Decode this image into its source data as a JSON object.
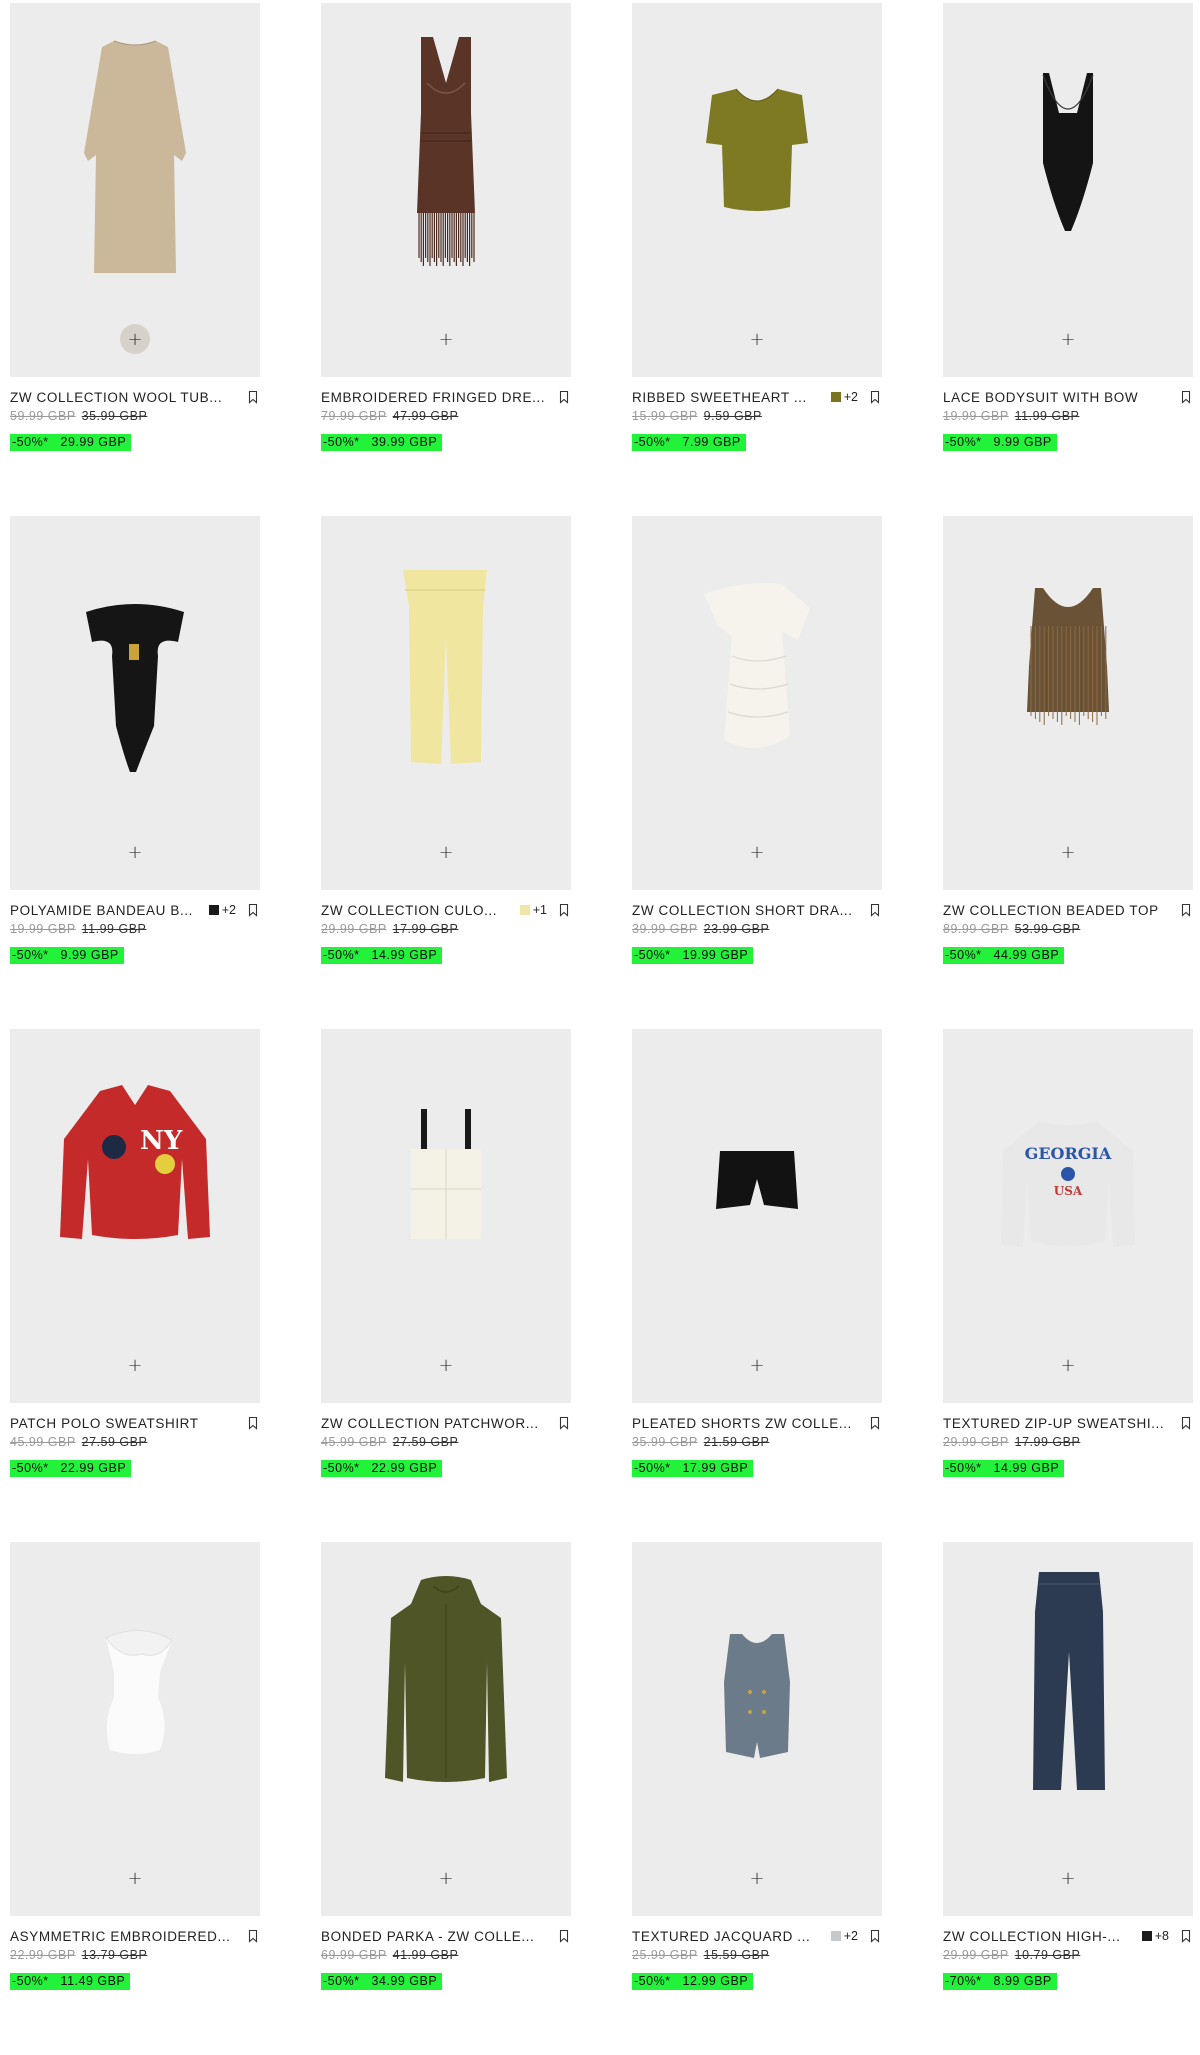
{
  "products": [
    {
      "name": "ZW COLLECTION WOOL TUB...",
      "old_price": "59.99 GBP",
      "mid_price": "35.99 GBP",
      "discount": "-50%*",
      "sale_price": "29.99 GBP",
      "swatch": null,
      "swatch_more": "",
      "add_label": "+",
      "art": "dress-long",
      "highlight": true
    },
    {
      "name": "EMBROIDERED FRINGED DRE...",
      "old_price": "79.99 GBP",
      "mid_price": "47.99 GBP",
      "discount": "-50%*",
      "sale_price": "39.99 GBP",
      "swatch": null,
      "swatch_more": "",
      "add_label": "+",
      "art": "dress-fringe",
      "highlight": false
    },
    {
      "name": "RIBBED SWEETHEART ...",
      "old_price": "15.99 GBP",
      "mid_price": "9.59 GBP",
      "discount": "-50%*",
      "sale_price": "7.99 GBP",
      "swatch": "#7a7420",
      "swatch_more": "+2",
      "add_label": "+",
      "art": "top-sweetheart",
      "highlight": false
    },
    {
      "name": "LACE BODYSUIT WITH BOW",
      "old_price": "19.99 GBP",
      "mid_price": "11.99 GBP",
      "discount": "-50%*",
      "sale_price": "9.99 GBP",
      "swatch": null,
      "swatch_more": "",
      "add_label": "+",
      "art": "bodysuit-lace",
      "highlight": false
    },
    {
      "name": "POLYAMIDE BANDEAU B...",
      "old_price": "19.99 GBP",
      "mid_price": "11.99 GBP",
      "discount": "-50%*",
      "sale_price": "9.99 GBP",
      "swatch": "#1a1a1a",
      "swatch_more": "+2",
      "add_label": "+",
      "art": "bodysuit-bandeau",
      "highlight": false
    },
    {
      "name": "ZW COLLECTION CULO...",
      "old_price": "29.99 GBP",
      "mid_price": "17.99 GBP",
      "discount": "-50%*",
      "sale_price": "14.99 GBP",
      "swatch": "#f1e4a8",
      "swatch_more": "+1",
      "add_label": "+",
      "art": "culottes",
      "highlight": false
    },
    {
      "name": "ZW COLLECTION SHORT DRA...",
      "old_price": "39.99 GBP",
      "mid_price": "23.99 GBP",
      "discount": "-50%*",
      "sale_price": "19.99 GBP",
      "swatch": null,
      "swatch_more": "",
      "add_label": "+",
      "art": "dress-short",
      "highlight": false
    },
    {
      "name": "ZW COLLECTION BEADED TOP",
      "old_price": "89.99 GBP",
      "mid_price": "53.99 GBP",
      "discount": "-50%*",
      "sale_price": "44.99 GBP",
      "swatch": null,
      "swatch_more": "",
      "add_label": "+",
      "art": "top-beaded",
      "highlight": false
    },
    {
      "name": "PATCH POLO SWEATSHIRT",
      "old_price": "45.99 GBP",
      "mid_price": "27.59 GBP",
      "discount": "-50%*",
      "sale_price": "22.99 GBP",
      "swatch": null,
      "swatch_more": "",
      "add_label": "+",
      "art": "sweatshirt-polo",
      "highlight": false
    },
    {
      "name": "ZW COLLECTION PATCHWOR...",
      "old_price": "45.99 GBP",
      "mid_price": "27.59 GBP",
      "discount": "-50%*",
      "sale_price": "22.99 GBP",
      "swatch": null,
      "swatch_more": "",
      "add_label": "+",
      "art": "top-patchwork",
      "highlight": false
    },
    {
      "name": "PLEATED SHORTS ZW COLLE...",
      "old_price": "35.99 GBP",
      "mid_price": "21.59 GBP",
      "discount": "-50%*",
      "sale_price": "17.99 GBP",
      "swatch": null,
      "swatch_more": "",
      "add_label": "+",
      "art": "shorts",
      "highlight": false
    },
    {
      "name": "TEXTURED ZIP-UP SWEATSHI...",
      "old_price": "29.99 GBP",
      "mid_price": "17.99 GBP",
      "discount": "-50%*",
      "sale_price": "14.99 GBP",
      "swatch": null,
      "swatch_more": "",
      "add_label": "+",
      "art": "sweatshirt-georgia",
      "highlight": false
    },
    {
      "name": "ASYMMETRIC EMBROIDERED...",
      "old_price": "22.99 GBP",
      "mid_price": "13.79 GBP",
      "discount": "-50%*",
      "sale_price": "11.49 GBP",
      "swatch": null,
      "swatch_more": "",
      "add_label": "+",
      "art": "top-ruffle",
      "highlight": false
    },
    {
      "name": "BONDED PARKA - ZW COLLE...",
      "old_price": "69.99 GBP",
      "mid_price": "41.99 GBP",
      "discount": "-50%*",
      "sale_price": "34.99 GBP",
      "swatch": null,
      "swatch_more": "",
      "add_label": "+",
      "art": "parka",
      "highlight": false
    },
    {
      "name": "TEXTURED JACQUARD ...",
      "old_price": "25.99 GBP",
      "mid_price": "15.59 GBP",
      "discount": "-50%*",
      "sale_price": "12.99 GBP",
      "swatch": "#c5c9cb",
      "swatch_more": "+2",
      "add_label": "+",
      "art": "waistcoat",
      "highlight": false
    },
    {
      "name": "ZW COLLECTION HIGH-...",
      "old_price": "29.99 GBP",
      "mid_price": "10.79 GBP",
      "discount": "-70%*",
      "sale_price": "8.99 GBP",
      "swatch": "#1a1a1a",
      "swatch_more": "+8",
      "add_label": "+",
      "art": "jeans",
      "highlight": false
    }
  ],
  "icons": {
    "bookmark": "bookmark-icon",
    "add": "plus-icon"
  }
}
